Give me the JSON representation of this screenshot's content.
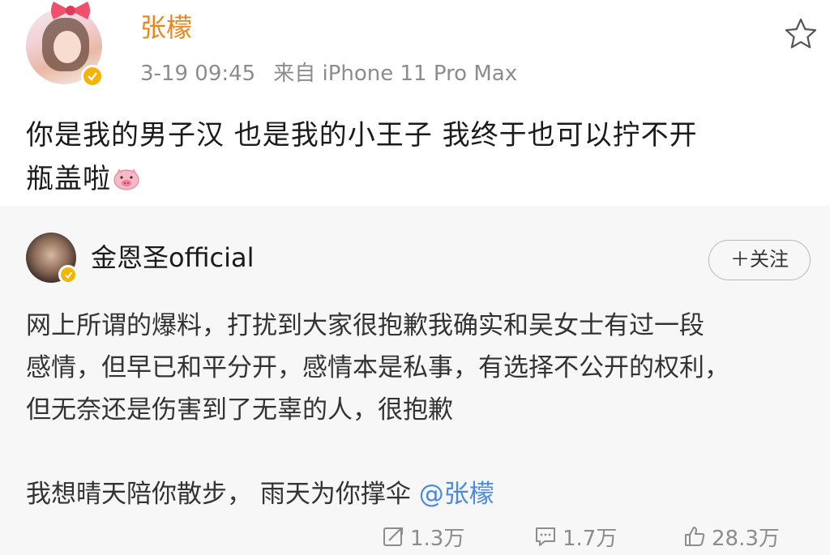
{
  "post": {
    "author": "张檬",
    "timestamp": "3-19 09:45",
    "source": "来自 iPhone 11 Pro Max",
    "text_line1": "你是我的男子汉  也是我的小王子  我终于也可以拧不开",
    "text_line2": "瓶盖啦",
    "emoji": "pig-emoji-icon",
    "name_color": "#e8871e"
  },
  "repost": {
    "author": "金恩圣official",
    "follow_label": "＋关注",
    "lines": [
      "网上所谓的爆料，打扰到大家很抱歉我确实和吴女士有过一段",
      "感情，但早已和平分开，感情本是私事，有选择不公开的权利，",
      "但无奈还是伤害到了无辜的人，很抱歉"
    ],
    "last_line_text": "我想晴天陪你散步，  雨天为你撑伞 ",
    "mention": "@张檬",
    "mention_color": "#4a8ae0",
    "actions": {
      "repost_count": "1.3万",
      "comment_count": "1.7万",
      "like_count": "28.3万"
    }
  }
}
